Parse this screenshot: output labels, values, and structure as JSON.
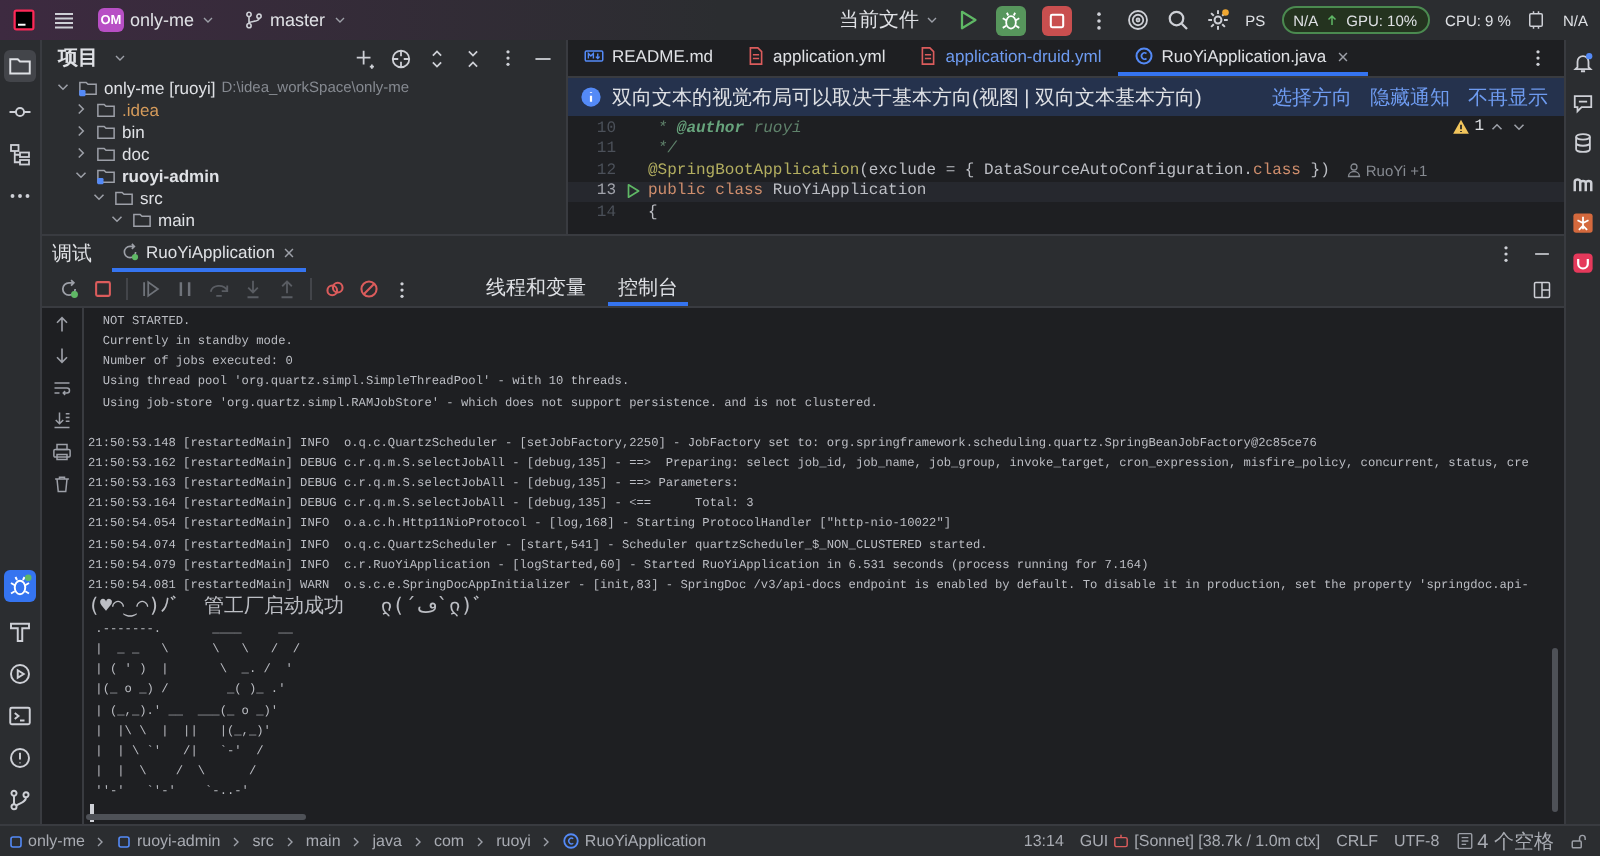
{
  "title_bar": {
    "project_badge": "OM",
    "project": "only-me",
    "branch": "master",
    "run_config": "当前文件",
    "ps": "PS",
    "gpu_left": "N/A",
    "gpu_right": "GPU: 10%",
    "cpu": "CPU: 9 %",
    "memory": "N/A"
  },
  "project_panel": {
    "title": "项目",
    "tree": [
      {
        "name": "only-me [ruoyi]",
        "path": "D:\\idea_workSpace\\only-me",
        "kind": "module",
        "expanded": true,
        "children": [
          {
            "name": ".idea",
            "kind": "excluded",
            "expanded": false
          },
          {
            "name": "bin",
            "kind": "folder",
            "expanded": false
          },
          {
            "name": "doc",
            "kind": "folder",
            "expanded": false
          },
          {
            "name": "ruoyi-admin",
            "kind": "module",
            "expanded": true,
            "children": [
              {
                "name": "src",
                "kind": "folder",
                "expanded": true,
                "children": [
                  {
                    "name": "main",
                    "kind": "folder",
                    "expanded": true
                  }
                ]
              }
            ]
          }
        ]
      }
    ]
  },
  "editor": {
    "tabs": [
      {
        "label": "README.md",
        "kind": "markdown",
        "modified": false,
        "selected": false
      },
      {
        "label": "application.yml",
        "kind": "yaml",
        "modified": false,
        "selected": false
      },
      {
        "label": "application-druid.yml",
        "kind": "yaml",
        "modified": true,
        "selected": false
      },
      {
        "label": "RuoYiApplication.java",
        "kind": "java",
        "modified": false,
        "selected": true
      }
    ],
    "notification": {
      "text": "双向文本的视觉布局可以取决于基本方向(视图 | 双向文本基本方向)",
      "actions": [
        "选择方向",
        "隐藏通知",
        "不再显示"
      ]
    },
    "warning_count": "1",
    "lines": [
      {
        "number": "10",
        "current": false,
        "run": false,
        "segments": [
          {
            "text": " * ",
            "kind": "comment"
          },
          {
            "text": "@author",
            "kind": "doc-tag"
          },
          {
            "text": " ruoyi",
            "kind": "comment"
          }
        ]
      },
      {
        "number": "11",
        "current": false,
        "run": false,
        "segments": [
          {
            "text": " */",
            "kind": "comment"
          }
        ]
      },
      {
        "number": "12",
        "current": false,
        "run": false,
        "segments": [
          {
            "text": "@SpringBootApplication",
            "kind": "annotation"
          },
          {
            "text": "(exclude = { DataSourceAutoConfiguration.",
            "kind": "plain"
          },
          {
            "text": "class",
            "kind": "keyword"
          },
          {
            "text": " })",
            "kind": "plain"
          }
        ],
        "hint": "RuoYi +1"
      },
      {
        "number": "13",
        "current": true,
        "run": true,
        "segments": [
          {
            "text": "public class ",
            "kind": "keyword"
          },
          {
            "text": "RuoYiApplication",
            "kind": "plain"
          }
        ]
      },
      {
        "number": "14",
        "current": false,
        "run": false,
        "segments": [
          {
            "text": "{",
            "kind": "plain"
          }
        ]
      }
    ]
  },
  "debug_panel": {
    "title": "调试",
    "session_tab": "RuoYiApplication",
    "tabs": [
      {
        "label": "线程和变量",
        "selected": false
      },
      {
        "label": "控制台",
        "selected": true
      }
    ],
    "console": [
      {
        "lines": [
          {
            "kind": "log",
            "text": "  NOT STARTED."
          },
          {
            "kind": "log",
            "text": "  Currently in standby mode."
          },
          {
            "kind": "log",
            "text": "  Number of jobs executed: 0"
          },
          {
            "kind": "log",
            "text": "  Using thread pool 'org.quartz.simpl.SimpleThreadPool' - with 10 threads."
          },
          {
            "kind": "log",
            "text": "  Using job-store 'org.quartz.simpl.RAMJobStore' - which does not support persistence. and is not clustered."
          }
        ]
      },
      {
        "lines": [
          {
            "kind": "log",
            "text": "21:50:53.148 [restartedMain] INFO  o.q.c.QuartzScheduler - [setJobFactory,2250] - JobFactory set to: org.springframework.scheduling.quartz.SpringBeanJobFactory@2c85ce76"
          },
          {
            "kind": "log",
            "text": "21:50:53.162 [restartedMain] DEBUG c.r.q.m.S.selectJobAll - [debug,135] - ==>  Preparing: select job_id, job_name, job_group, invoke_target, cron_expression, misfire_policy, concurrent, status, cre"
          },
          {
            "kind": "log",
            "text": "21:50:53.163 [restartedMain] DEBUG c.r.q.m.S.selectJobAll - [debug,135] - ==> Parameters:"
          },
          {
            "kind": "log",
            "text": "21:50:53.164 [restartedMain] DEBUG c.r.q.m.S.selectJobAll - [debug,135] - <==      Total: 3"
          },
          {
            "kind": "log",
            "text": "21:50:54.054 [restartedMain] INFO  o.a.c.h.Http11NioProtocol - [log,168] - Starting ProtocolHandler [\"http-nio-10022\"]"
          },
          {
            "kind": "log",
            "text": "21:50:54.074 [restartedMain] INFO  o.q.c.QuartzScheduler - [start,541] - Scheduler quartzScheduler_$_NON_CLUSTERED started."
          },
          {
            "kind": "log",
            "text": "21:50:54.079 [restartedMain] INFO  c.r.RuoYiApplication - [logStarted,60] - Started RuoYiApplication in 6.531 seconds (process running for 7.164)"
          },
          {
            "kind": "log",
            "text": "21:50:54.081 [restartedMain] WARN  o.s.c.e.SpringDocAppInitializer - [init,83] - SpringDoc /v3/api-docs endpoint is enabled by default. To disable it in production, set the property 'springdoc.api-"
          },
          {
            "kind": "banner",
            "text": "(♥◠‿◠)ﾉﾞ  管工厂启动成功   ლ(´ڡ`ლ)ﾞ"
          },
          {
            "kind": "art",
            "text": " .-------.       ____     __"
          },
          {
            "kind": "art",
            "text": " |  _ _   \\      \\   \\   /  /"
          },
          {
            "kind": "art",
            "text": " | ( ' )  |       \\  _. /  '"
          },
          {
            "kind": "art",
            "text": " |(_ o _) /        _( )_ .'"
          },
          {
            "kind": "art",
            "text": " | (_,_).' __  ___(_ o _)'"
          },
          {
            "kind": "art",
            "text": " |  |\\ \\  |  ||   |(_,_)'"
          },
          {
            "kind": "art",
            "text": " |  | \\ `'   /|   `-'  /"
          },
          {
            "kind": "art",
            "text": " |  |  \\    /  \\      /"
          },
          {
            "kind": "art",
            "text": " ''-'   `'-'    `-..-'"
          }
        ]
      }
    ]
  },
  "status_bar": {
    "breadcrumbs": [
      {
        "label": "only-me",
        "kind": "module"
      },
      {
        "label": "ruoyi-admin",
        "kind": "module"
      },
      {
        "label": "src",
        "kind": "folder"
      },
      {
        "label": "main",
        "kind": "folder"
      },
      {
        "label": "java",
        "kind": "folder"
      },
      {
        "label": "com",
        "kind": "folder"
      },
      {
        "label": "ruoyi",
        "kind": "folder"
      },
      {
        "label": "RuoYiApplication",
        "kind": "class"
      }
    ],
    "position": "13:14",
    "gui": "GUI",
    "ai": "[Sonnet] [38.7k / 1.0m ctx]",
    "line_ending": "CRLF",
    "encoding": "UTF-8",
    "indent": "4 个空格"
  }
}
